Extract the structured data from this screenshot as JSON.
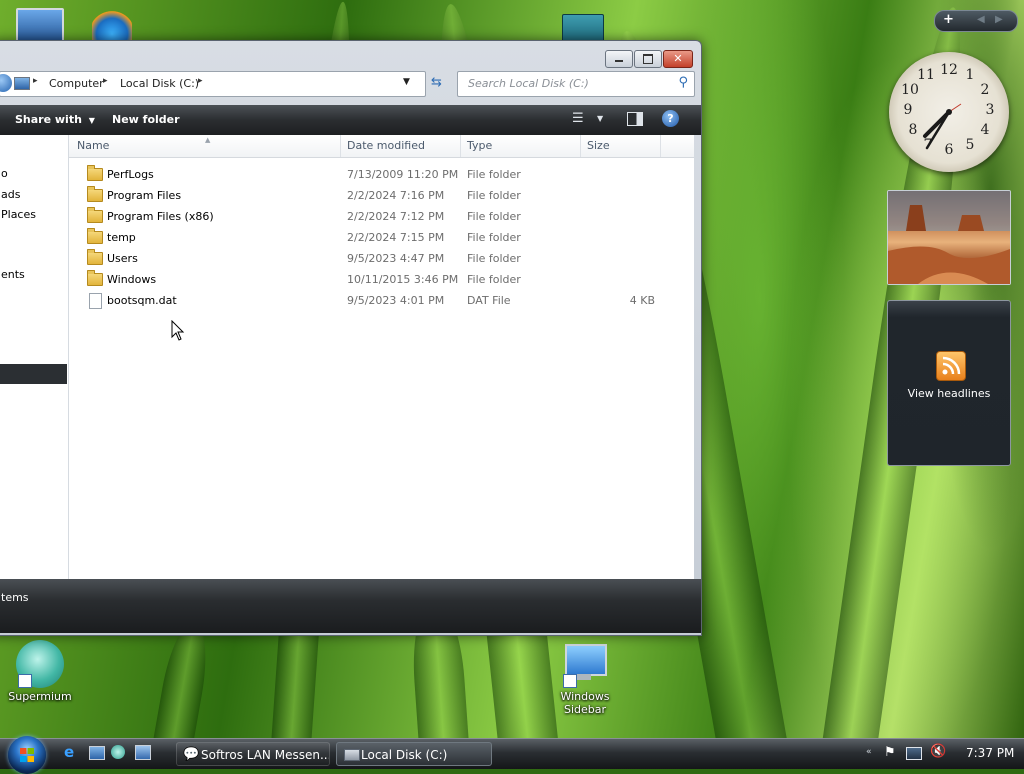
{
  "desktop": {
    "icons": [
      {
        "label": "Supermium"
      },
      {
        "label": "Windows Sidebar"
      }
    ]
  },
  "explorer": {
    "breadcrumb": [
      "Computer",
      "Local Disk (C:)"
    ],
    "search_placeholder": "Search Local Disk (C:)",
    "toolbar": {
      "share_with": "Share with",
      "new_folder": "New folder"
    },
    "nav_items": [
      "o",
      "ads",
      "Places",
      "ents"
    ],
    "columns": {
      "name": "Name",
      "date_modified": "Date modified",
      "type": "Type",
      "size": "Size"
    },
    "files": [
      {
        "name": "PerfLogs",
        "date": "7/13/2009 11:20 PM",
        "type": "File folder",
        "size": "",
        "icon": "folder-icon"
      },
      {
        "name": "Program Files",
        "date": "2/2/2024 7:16 PM",
        "type": "File folder",
        "size": "",
        "icon": "folder-icon"
      },
      {
        "name": "Program Files (x86)",
        "date": "2/2/2024 7:12 PM",
        "type": "File folder",
        "size": "",
        "icon": "folder-icon"
      },
      {
        "name": "temp",
        "date": "2/2/2024 7:15 PM",
        "type": "File folder",
        "size": "",
        "icon": "folder-icon"
      },
      {
        "name": "Users",
        "date": "9/5/2023 4:47 PM",
        "type": "File folder",
        "size": "",
        "icon": "folder-icon"
      },
      {
        "name": "Windows",
        "date": "10/11/2015 3:46 PM",
        "type": "File folder",
        "size": "",
        "icon": "folder-icon"
      },
      {
        "name": "bootsqm.dat",
        "date": "9/5/2023 4:01 PM",
        "type": "DAT File",
        "size": "4 KB",
        "icon": "file-icon"
      }
    ],
    "status_text": "tems"
  },
  "sidebar": {
    "clock_numbers": [
      "12",
      "1",
      "2",
      "3",
      "4",
      "5",
      "6",
      "7",
      "8",
      "9",
      "10",
      "11"
    ],
    "feed_label": "View headlines"
  },
  "taskbar": {
    "buttons": [
      {
        "label": "Softros LAN Messen..."
      },
      {
        "label": "Local Disk (C:)"
      }
    ],
    "clock": "7:37 PM"
  },
  "colors": {
    "accent": "#2b74c8",
    "rss": "#f29b2b"
  }
}
